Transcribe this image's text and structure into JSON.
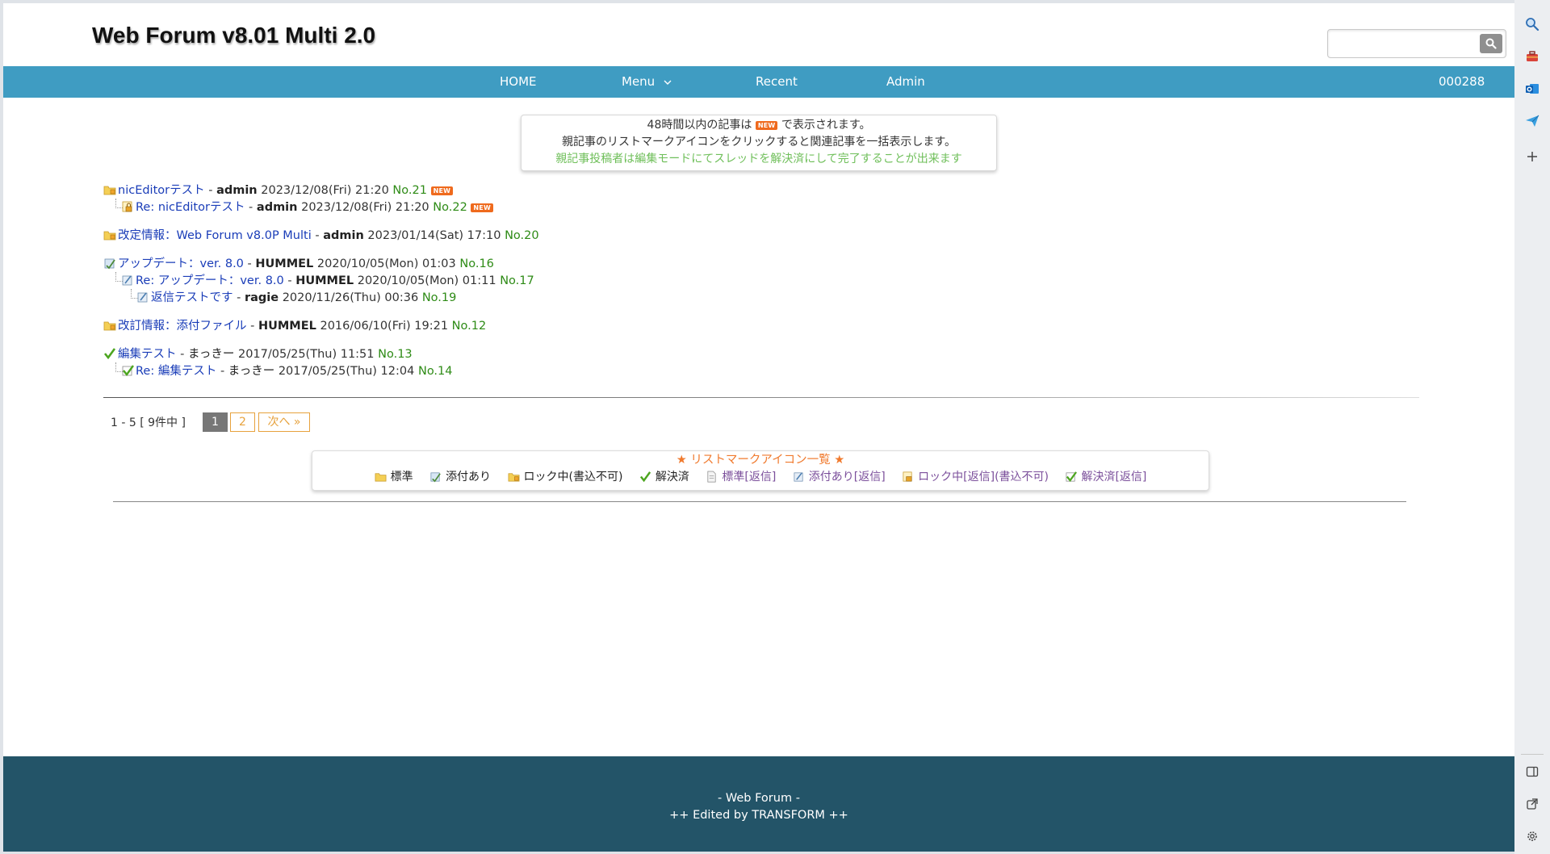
{
  "header": {
    "site_title": "Web Forum v8.01 Multi 2.0",
    "search_placeholder": ""
  },
  "nav": {
    "home": "HOME",
    "menu": "Menu",
    "recent": "Recent",
    "admin": "Admin",
    "counter": "000288"
  },
  "notice": {
    "line1_before": "48時間以内の記事は",
    "line1_after": "で表示されます。",
    "line2": "親記事のリストマークアイコンをクリックすると関連記事を一括表示します。",
    "line3": "親記事投稿者は編集モードにてスレッドを解決済にして完了することが出来ます"
  },
  "badge_new": "NEW",
  "separator": " - ",
  "posts": [
    {
      "title": "nicEditorテスト",
      "author": "admin",
      "date": "2023/12/08(Fri) 21:20",
      "no": "No.21",
      "new": true
    },
    {
      "title": "Re: nicEditorテスト",
      "author": "admin",
      "date": "2023/12/08(Fri) 21:20",
      "no": "No.22",
      "new": true
    },
    {
      "title": "改定情報：Web Forum v8.0P Multi",
      "author": "admin",
      "date": "2023/01/14(Sat) 17:10",
      "no": "No.20"
    },
    {
      "title": "アップデート：ver. 8.0",
      "author": "HUMMEL",
      "date": "2020/10/05(Mon) 01:03",
      "no": "No.16"
    },
    {
      "title": "Re: アップデート：ver. 8.0",
      "author": "HUMMEL",
      "date": "2020/10/05(Mon) 01:11",
      "no": "No.17"
    },
    {
      "title": "返信テストです",
      "author": "ragie",
      "date": "2020/11/26(Thu) 00:36",
      "no": "No.19"
    },
    {
      "title": "改訂情報：添付ファイル",
      "author": "HUMMEL",
      "date": "2016/06/10(Fri) 19:21",
      "no": "No.12"
    },
    {
      "title": "編集テスト",
      "author": "まっきー",
      "date": "2017/05/25(Thu) 11:51",
      "no": "No.13"
    },
    {
      "title": "Re: 編集テスト",
      "author": "まっきー",
      "date": "2017/05/25(Thu) 12:04",
      "no": "No.14"
    }
  ],
  "pager": {
    "summary": "1 - 5 [ 9件中 ]",
    "page1": "1",
    "page2": "2",
    "next": "次へ »"
  },
  "legend": {
    "title": "★ リストマークアイコン一覧 ★",
    "items": [
      "標準",
      "添付あり",
      "ロック中(書込不可)",
      "解決済",
      "標準[返信]",
      "添付あり[返信]",
      "ロック中[返信](書込不可)",
      "解決済[返信]"
    ]
  },
  "footer": {
    "line1": "- Web Forum -",
    "line2": "++ Edited by TRANSFORM ++"
  },
  "colors": {
    "nav_bg": "#3f9cc2",
    "footer_bg": "#235468",
    "link": "#1a3db8",
    "post_no": "#2e8b16",
    "accent": "#f07a2e"
  },
  "icons": {
    "rail": [
      "search-icon",
      "toolbox-icon",
      "outlook-icon",
      "send-icon",
      "plus-icon",
      "sidebar-icon",
      "external-link-icon",
      "gear-icon"
    ]
  }
}
